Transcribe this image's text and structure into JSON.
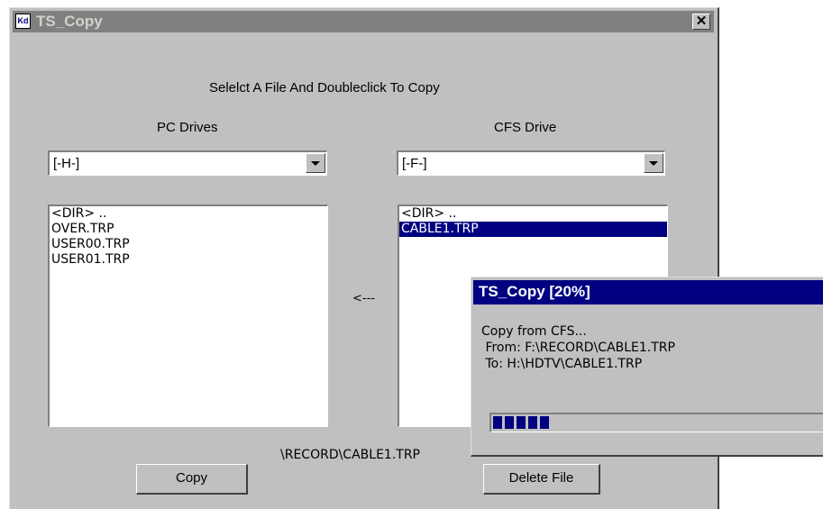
{
  "window": {
    "icon": "app-icon",
    "icon_text": "Kd",
    "title": "TS_Copy",
    "close_label": "✕"
  },
  "instruction": "Selelct A File And Doubleclick To Copy",
  "pc": {
    "label": "PC Drives",
    "drive": "[-H-]",
    "files": [
      "<DIR> ..",
      "OVER.TRP",
      "USER00.TRP",
      "USER01.TRP"
    ]
  },
  "cfs": {
    "label": "CFS Drive",
    "drive": "[-F-]",
    "files": [
      "<DIR> ..",
      "CABLE1.TRP"
    ],
    "selected_index": 1
  },
  "direction_arrow": "<---",
  "current_path": "\\RECORD\\CABLE1.TRP",
  "buttons": {
    "copy": "Copy",
    "delete": "Delete File"
  },
  "progress_dialog": {
    "title": "TS_Copy [20%]",
    "line1": "Copy from CFS...",
    "line2": " From: F:\\RECORD\\CABLE1.TRP",
    "line3": " To: H:\\HDTV\\CABLE1.TRP",
    "progress_percent": 20,
    "filled_blocks": 5
  },
  "colors": {
    "face": "#c0c0c0",
    "inactive_title": "#808080",
    "active_title": "#000080",
    "selection": "#000080"
  }
}
